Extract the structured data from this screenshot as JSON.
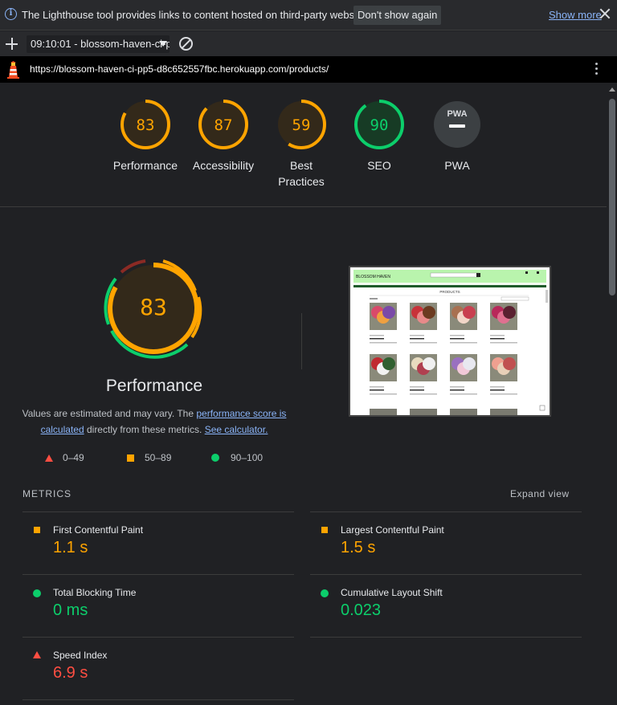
{
  "infobar": {
    "message": "The Lighthouse tool provides links to content hosted on third-party websites.",
    "dont_show": "Don't show again",
    "show_more": "Show more"
  },
  "toolbar": {
    "report_select": "09:10:01 - blossom-haven-ci-p"
  },
  "urlbar": {
    "url": "https://blossom-haven-ci-pp5-d8c652557fbc.herokuapp.com/products/"
  },
  "gauges": [
    {
      "label": "Performance",
      "score": "83",
      "value": 0.83,
      "color": "#ffa400",
      "bg": "#33291a"
    },
    {
      "label": "Accessibility",
      "score": "87",
      "value": 0.87,
      "color": "#ffa400",
      "bg": "#33291a"
    },
    {
      "label": "Best Practices",
      "score": "59",
      "value": 0.59,
      "color": "#ffa400",
      "bg": "#33291a"
    },
    {
      "label": "SEO",
      "score": "90",
      "value": 0.9,
      "color": "#0cce6b",
      "bg": "#173b25"
    },
    {
      "label": "PWA",
      "score": "PWA",
      "value": 0,
      "color": "#9aa0a6",
      "bg": "#3c4043"
    }
  ],
  "performance": {
    "score": "83",
    "title": "Performance",
    "desc_prefix": "Values are estimated and may vary. The ",
    "link1": "performance score is calculated",
    "desc_mid": " directly from these metrics. ",
    "link2": "See calculator."
  },
  "legend": {
    "fail": "0–49",
    "average": "50–89",
    "pass": "90–100"
  },
  "colors": {
    "fail": "#ff4e42",
    "average": "#ffa400",
    "pass": "#0cce6b"
  },
  "metrics": {
    "heading": "METRICS",
    "expand": "Expand view",
    "fcp": {
      "name": "First Contentful Paint",
      "value": "1.1 s",
      "rating": "average"
    },
    "lcp": {
      "name": "Largest Contentful Paint",
      "value": "1.5 s",
      "rating": "average"
    },
    "tbt": {
      "name": "Total Blocking Time",
      "value": "0 ms",
      "rating": "pass"
    },
    "cls": {
      "name": "Cumulative Layout Shift",
      "value": "0.023",
      "rating": "pass"
    },
    "si": {
      "name": "Speed Index",
      "value": "6.9 s",
      "rating": "fail"
    }
  },
  "screenshot": {
    "brand": "BLOSSOM HAVEN",
    "heading": "PRODUCTS"
  }
}
